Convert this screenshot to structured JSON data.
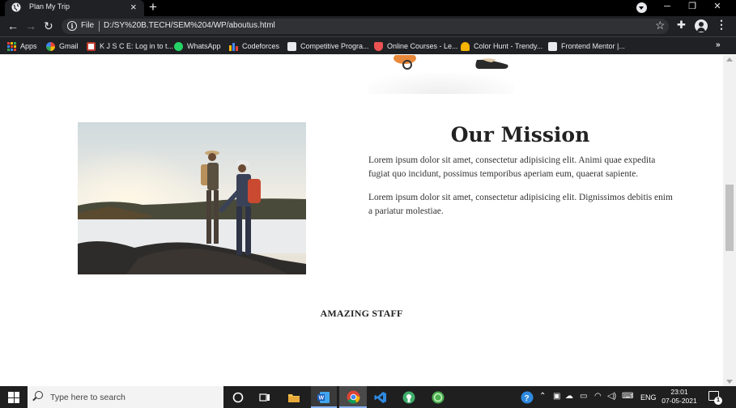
{
  "browser": {
    "tab_title": "Plan My Trip",
    "tab_close": "×",
    "new_tab": "+",
    "window_buttons": {
      "minimize": "─",
      "restore": "❐",
      "close": "✕"
    },
    "nav": {
      "back": "←",
      "forward": "→",
      "reload": "↻"
    },
    "address": {
      "scheme_label": "File",
      "url": "D:/SY%20B.TECH/SEM%204/WP/aboutus.html"
    },
    "star": "☆",
    "extensions_icon": "✚",
    "menu": "⋮",
    "bookmarks": [
      {
        "label": "Apps",
        "icon": "apps-grid-icon",
        "color": "#4285f4"
      },
      {
        "label": "Gmail",
        "icon": "google-icon",
        "color": "#ea4335"
      },
      {
        "label": "K J S C E: Log in to t...",
        "icon": "kjsce-icon",
        "color": "#c0392b"
      },
      {
        "label": "WhatsApp",
        "icon": "whatsapp-icon",
        "color": "#25d366"
      },
      {
        "label": "Codeforces",
        "icon": "codeforces-icon",
        "color": "#1f8acb"
      },
      {
        "label": "Competitive Progra...",
        "icon": "cc-icon",
        "color": "#8b6a4f"
      },
      {
        "label": "Online Courses - Le...",
        "icon": "udemy-icon",
        "color": "#ec5252"
      },
      {
        "label": "Color Hunt - Trendy...",
        "icon": "colorhunt-icon",
        "color": "#f4b400"
      },
      {
        "label": "Frontend Mentor |...",
        "icon": "frontend-mentor-icon",
        "color": "#e8eaed"
      }
    ],
    "bookmarks_more": "»"
  },
  "page": {
    "mission_title": "Our Mission",
    "mission_paragraphs": [
      "Lorem ipsum dolor sit amet, consectetur adipisicing elit. Animi quae expedita fugiat quo incidunt, possimus temporibus aperiam eum, quaerat sapiente.",
      "Lorem ipsum dolor sit amet, consectetur adipisicing elit. Dignissimos debitis enim a pariatur molestiae."
    ],
    "staff_heading": "AMAZING STAFF"
  },
  "taskbar": {
    "search_placeholder": "Type here to search",
    "pinned": [
      "task-view-icon",
      "file-explorer-icon",
      "word-icon",
      "chrome-icon",
      "vscode-icon",
      "app-green-icon",
      "app-green-2-icon"
    ],
    "tray": {
      "language": "ENG",
      "time": "23:01",
      "date": "07-05-2021",
      "notification_count": "1"
    }
  },
  "colors": {
    "chrome_dark": "#202124",
    "accent_blue": "#8ab4f8",
    "taskbar": "#1f1f1f"
  }
}
